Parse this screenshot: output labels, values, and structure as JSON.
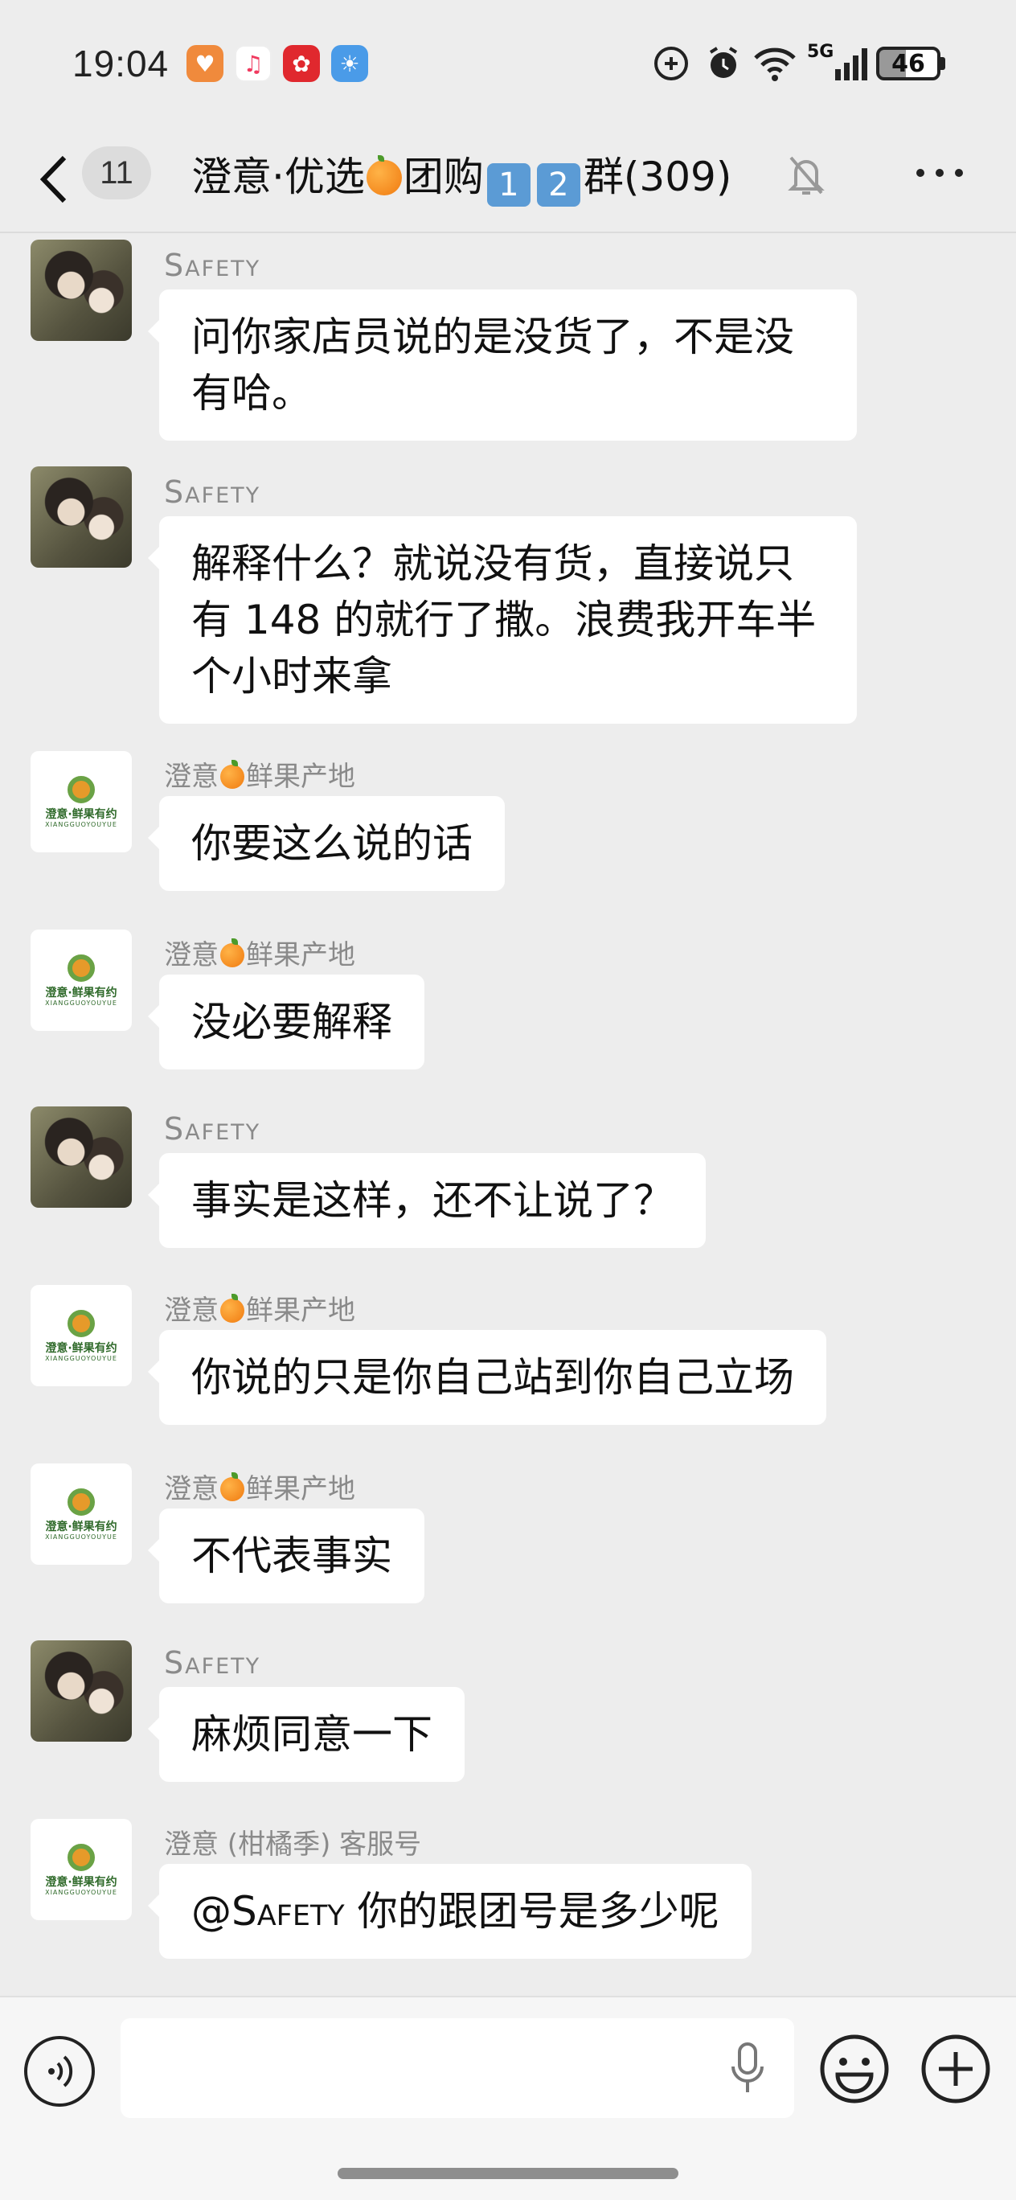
{
  "status_bar": {
    "time": "19:04",
    "network": "5G",
    "battery": "46",
    "app_icons": [
      "health-app-icon",
      "music-app-icon",
      "lucky-app-icon",
      "weather-app-icon"
    ]
  },
  "nav": {
    "unread_count": "11",
    "title": "澄意·优选🍊团购1️⃣2️⃣群(309)",
    "title_parts": {
      "prefix": "澄意·优选",
      "middle": "团购",
      "n1": "1",
      "n2": "2",
      "suffix": "群(309)"
    }
  },
  "messages": [
    {
      "sender": "Safety",
      "avatar": "person",
      "lines": [
        "问你家店员说的是没货了，不是没",
        "有哈。"
      ]
    },
    {
      "sender": "Safety",
      "avatar": "person",
      "lines": [
        "解释什么？就说没有货，直接说只",
        "有 148 的就行了撒。浪费我开车半",
        "个小时来拿"
      ]
    },
    {
      "sender": "澄意🍊鲜果产地",
      "sender_parts": [
        "澄意",
        "鲜果产地"
      ],
      "avatar": "logo",
      "lines": [
        "你要这么说的话"
      ]
    },
    {
      "sender": "澄意🍊鲜果产地",
      "sender_parts": [
        "澄意",
        "鲜果产地"
      ],
      "avatar": "logo",
      "lines": [
        "没必要解释"
      ]
    },
    {
      "sender": "Safety",
      "avatar": "person",
      "lines": [
        "事实是这样，还不让说了？"
      ]
    },
    {
      "sender": "澄意🍊鲜果产地",
      "sender_parts": [
        "澄意",
        "鲜果产地"
      ],
      "avatar": "logo",
      "lines": [
        "你说的只是你自己站到你自己立场"
      ]
    },
    {
      "sender": "澄意🍊鲜果产地",
      "sender_parts": [
        "澄意",
        "鲜果产地"
      ],
      "avatar": "logo",
      "lines": [
        "不代表事实"
      ]
    },
    {
      "sender": "Safety",
      "avatar": "person",
      "lines": [
        "麻烦同意一下"
      ]
    },
    {
      "sender": "澄意 (柑橘季) 客服号",
      "avatar": "logo",
      "lines": [
        "@Safety 你的跟团号是多少呢"
      ],
      "mention": "@Safety",
      "rest": " 你的跟团号是多少呢"
    }
  ],
  "logo": {
    "text": "澄意·鲜果有约",
    "sub": "XIANGGUOYOUYUE"
  },
  "input": {
    "value": "",
    "placeholder": ""
  }
}
